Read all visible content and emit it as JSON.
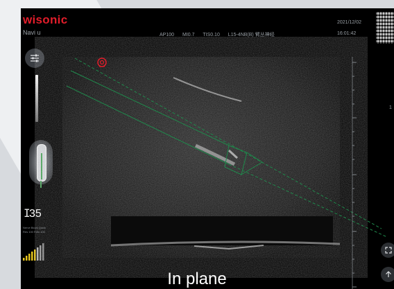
{
  "header": {
    "brand": "wisonic",
    "mode": "Navi u",
    "params": [
      "AP100",
      "MI0.7",
      "TIS0.10",
      "L15-4NB(B) 臂丛神经"
    ],
    "date": "2021/12/02",
    "time": "16:01:42"
  },
  "left_panel": {
    "depth_value": "35",
    "info_line1": "Nerve  Block Quick",
    "info_line2": "Res 100  Fdm  100"
  },
  "ruler": {
    "label": "1"
  },
  "caption": "In plane",
  "colors": {
    "brand": "#e11d2a",
    "needle_guide": "#1f8a4c",
    "signal": "#e4c31c",
    "target_marker": "#e11d2a"
  },
  "icons": {
    "settings": "sliders-icon",
    "probe": "probe-icon",
    "depth": "depth-icon",
    "signal": "signal-bars-icon",
    "target": "target-marker-icon",
    "fullscreen": "fullscreen-icon",
    "up": "arrow-up-icon"
  }
}
